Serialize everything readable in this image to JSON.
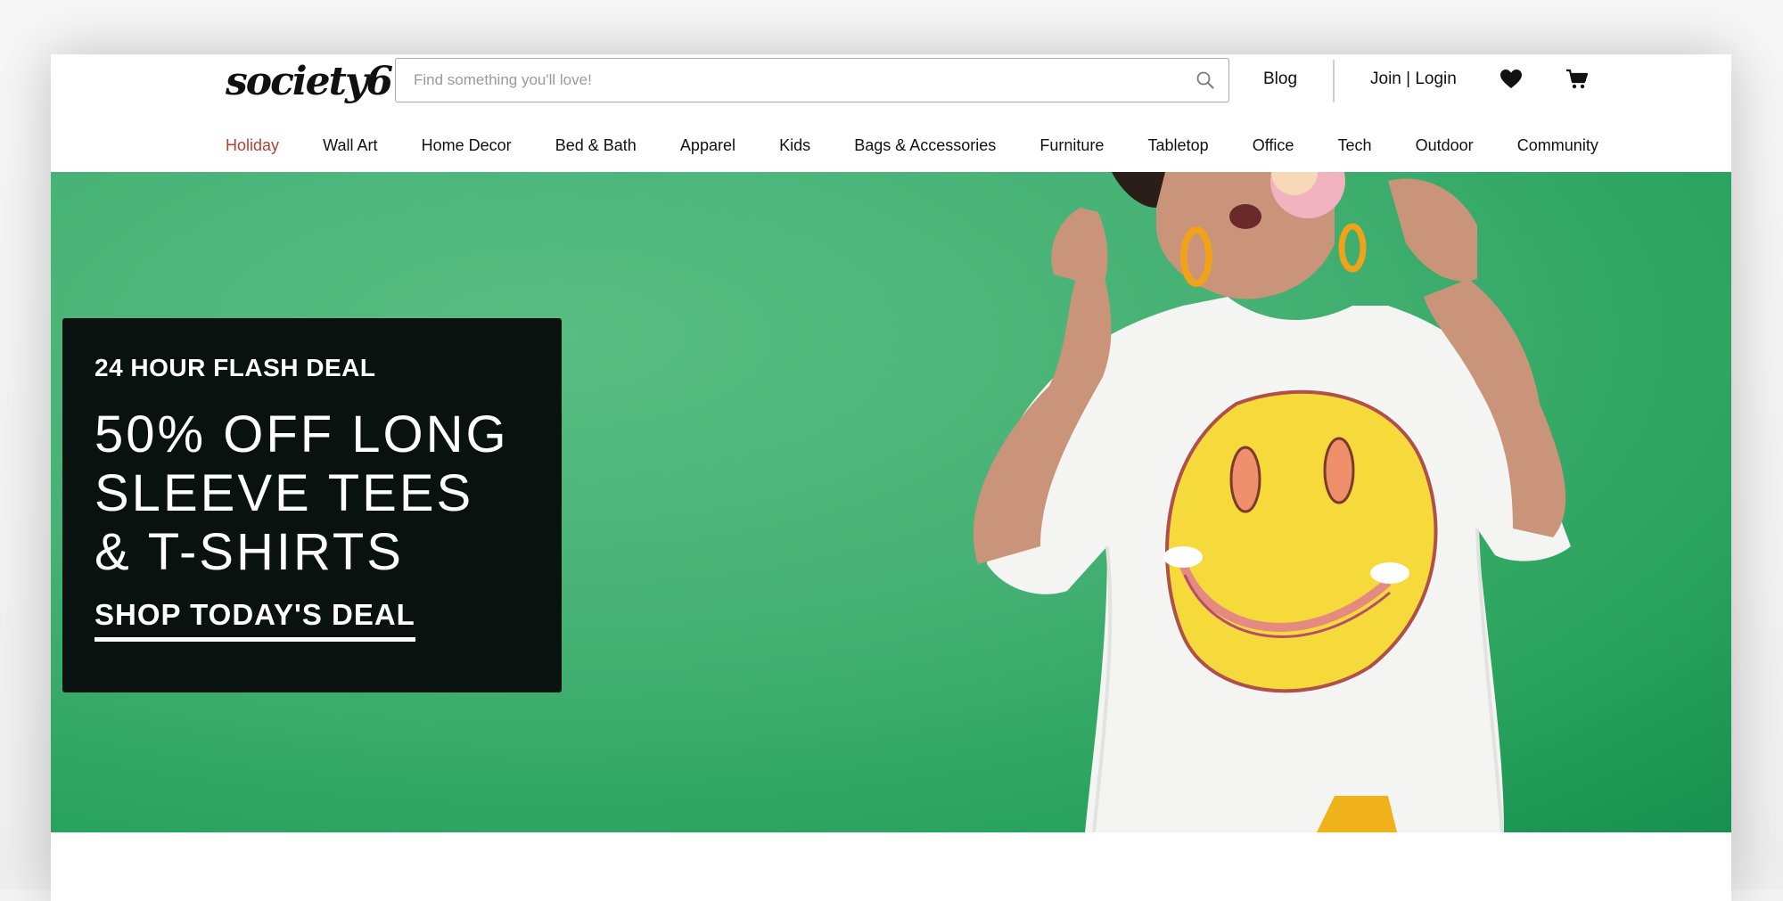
{
  "header": {
    "logo": "society6",
    "search_placeholder": "Find something you'll love!",
    "blog_label": "Blog",
    "login_label": "Join | Login"
  },
  "nav": {
    "items": [
      {
        "label": "Holiday"
      },
      {
        "label": "Wall Art"
      },
      {
        "label": "Home Decor"
      },
      {
        "label": "Bed & Bath"
      },
      {
        "label": "Apparel"
      },
      {
        "label": "Kids"
      },
      {
        "label": "Bags & Accessories"
      },
      {
        "label": "Furniture"
      },
      {
        "label": "Tabletop"
      },
      {
        "label": "Office"
      },
      {
        "label": "Tech"
      },
      {
        "label": "Outdoor"
      },
      {
        "label": "Community"
      }
    ],
    "active_color": "#b5412f"
  },
  "hero": {
    "kicker": "24 HOUR FLASH DEAL",
    "title": "50% OFF LONG SLEEVE TEES & T-SHIRTS",
    "cta": "SHOP TODAY'S DEAL",
    "background_color": "#47b275",
    "box_color": "#0a1210"
  },
  "icons": [
    "search-icon",
    "heart-icon",
    "cart-icon"
  ]
}
